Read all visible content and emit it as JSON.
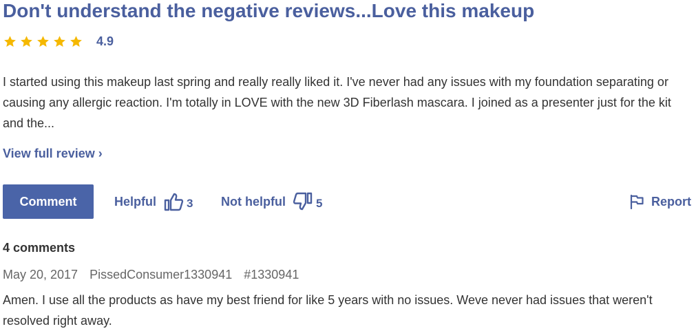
{
  "review": {
    "title": "Don't understand the negative reviews...Love this makeup",
    "rating": {
      "stars": 5,
      "value": "4.9",
      "star_color": "#f5b800"
    },
    "body": "I started using this makeup last spring and really really liked it. I've never had any issues with my foundation separating or causing any allergic reaction. I'm totally in LOVE with the new 3D Fiberlash mascara. I joined as a presenter just for the kit and the...",
    "view_full_label": "View full review ›"
  },
  "actions": {
    "comment_label": "Comment",
    "helpful_label": "Helpful",
    "helpful_count": "3",
    "helpful_icon": "thumbs-up-icon",
    "not_helpful_label": "Not helpful",
    "not_helpful_count": "5",
    "not_helpful_icon": "thumbs-down-icon",
    "report_label": "Report",
    "report_icon": "flag-icon"
  },
  "comments": {
    "count_label": "4 comments",
    "items": [
      {
        "date": "May 20, 2017",
        "author": "PissedConsumer1330941",
        "id": "#1330941",
        "text": "Amen. I use all the products as have my best friend for like 5 years with no issues. Weve never had issues that weren't resolved right away."
      }
    ]
  },
  "colors": {
    "accent": "#4a5f9e",
    "button": "#4a64a8",
    "text": "#333333",
    "muted": "#666666"
  }
}
